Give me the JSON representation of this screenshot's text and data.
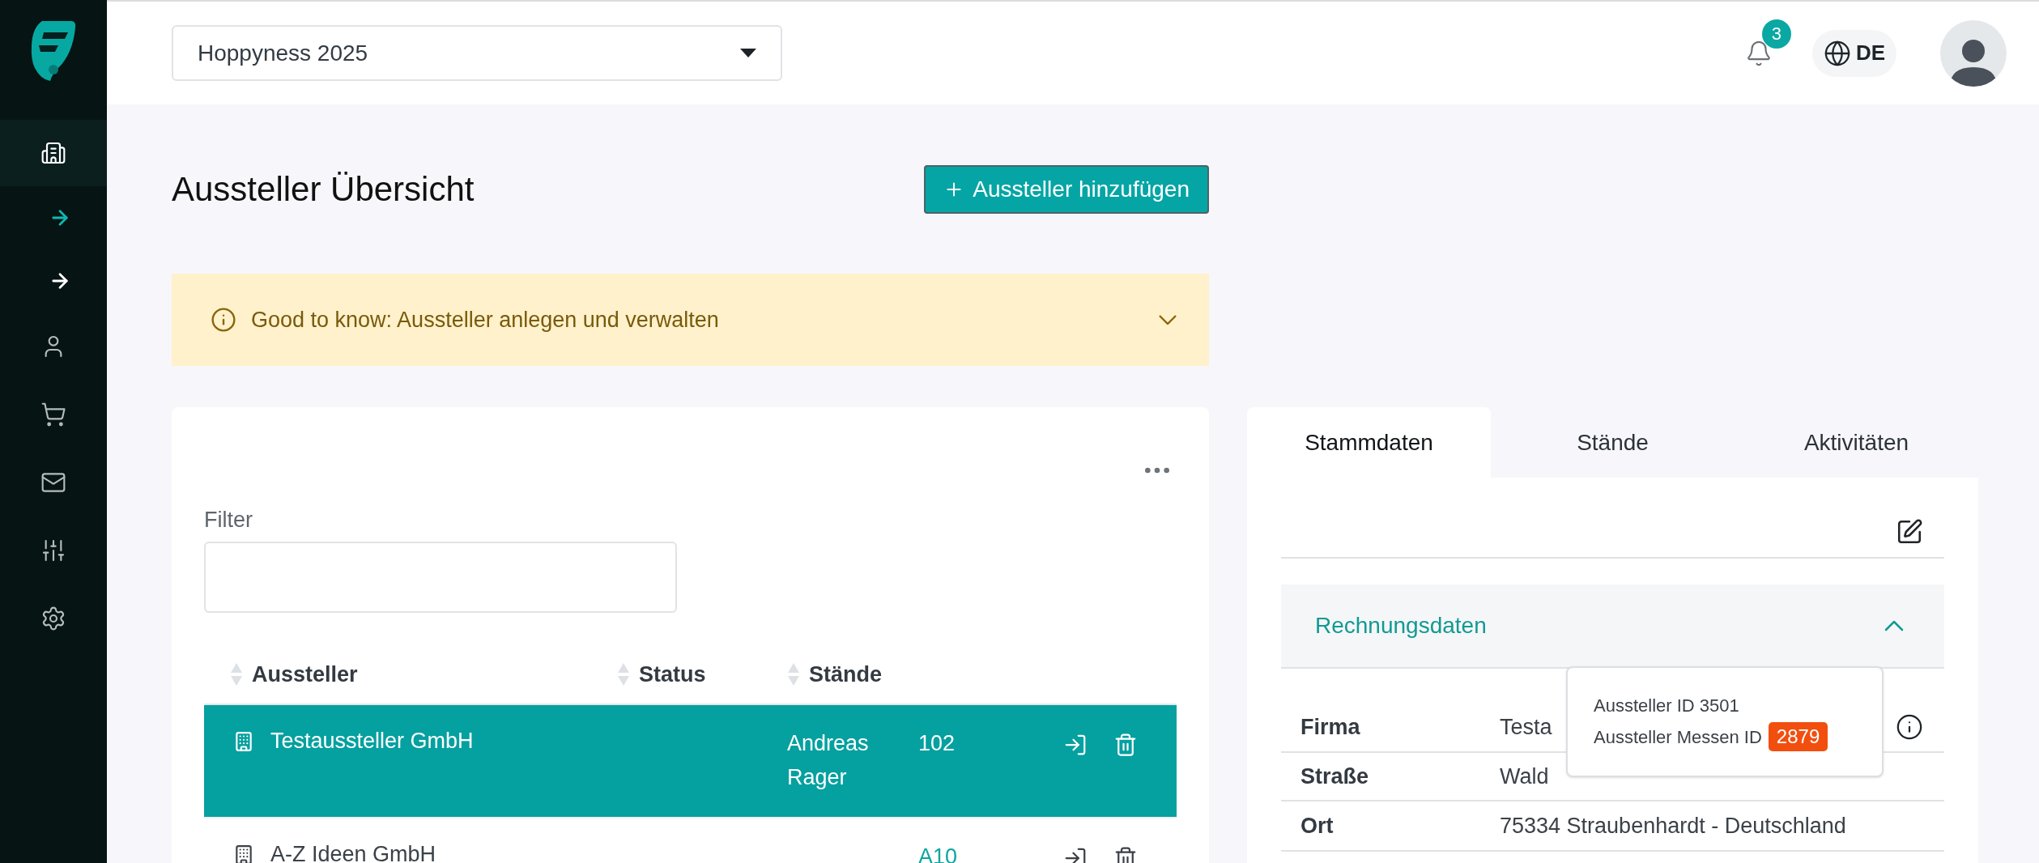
{
  "sidebar": {
    "items": [
      {
        "kind": "main",
        "selected": true
      },
      {
        "kind": "sub",
        "selected": true
      },
      {
        "kind": "sub",
        "selected": false
      },
      {
        "kind": "main",
        "selected": false
      },
      {
        "kind": "main",
        "selected": false
      },
      {
        "kind": "main",
        "selected": false
      },
      {
        "kind": "main",
        "selected": false
      },
      {
        "kind": "main",
        "selected": false
      }
    ]
  },
  "header": {
    "event_select": "Hoppyness 2025",
    "notification_count": "3",
    "language": "DE"
  },
  "page": {
    "title": "Aussteller Übersicht",
    "add_button": "Aussteller hinzufügen"
  },
  "info_banner": {
    "text": "Good to know: Aussteller anlegen und verwalten",
    "expanded": false
  },
  "exhibitor_list": {
    "filter_label": "Filter",
    "columns": [
      "Aussteller",
      "Status",
      "Stände"
    ],
    "rows": [
      {
        "name": "Testaussteller GmbH",
        "contact": "Andreas Rager",
        "stand": "102",
        "selected": true
      },
      {
        "name": "A-Z Ideen GmbH",
        "stand": "A10",
        "selected": false
      }
    ]
  },
  "detail_panel": {
    "tabs": [
      {
        "label": "Stammdaten",
        "selected": true
      },
      {
        "label": "Stände",
        "selected": false
      },
      {
        "label": "Aktivitäten",
        "selected": false
      }
    ],
    "section": {
      "title": "Rechnungsdaten",
      "expanded": true,
      "fields": [
        {
          "label": "Firma",
          "value": "Testa"
        },
        {
          "label": "Straße",
          "value": "Wald"
        },
        {
          "label": "Ort",
          "value": "75334 Straubenhardt - Deutschland"
        }
      ]
    },
    "tooltip": {
      "lines": [
        {
          "text": "Aussteller ID 3501"
        },
        {
          "text": "Aussteller Messen ID",
          "badge": "2879"
        }
      ]
    }
  }
}
